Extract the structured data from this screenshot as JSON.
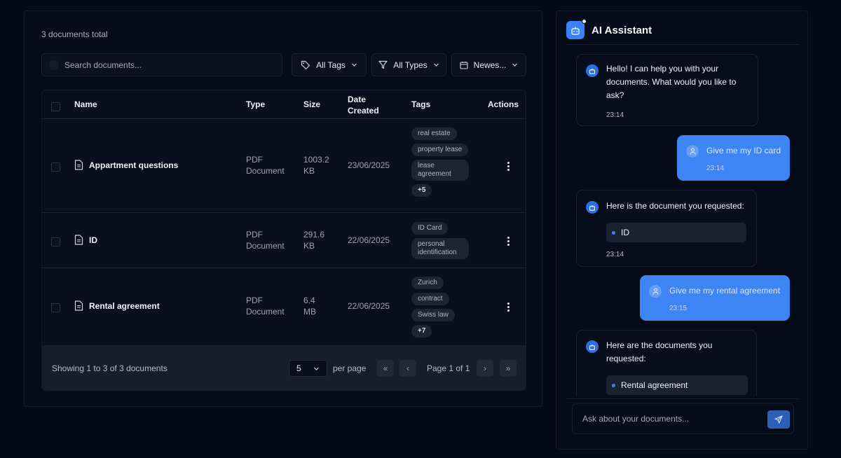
{
  "documents": {
    "count_label": "3 documents total",
    "search": {
      "placeholder": "Search documents..."
    },
    "filters": {
      "tags": "All Tags",
      "types": "All Types",
      "sort": "Newes..."
    },
    "columns": {
      "name": "Name",
      "type_line1": "Type",
      "size": "Size",
      "date_line1": "Date",
      "date_line2": "Created",
      "tags": "Tags",
      "actions": "Actions"
    },
    "rows": [
      {
        "name": "Appartment questions",
        "type_line1": "PDF",
        "type_line2": "Document",
        "size_line1": "1003.2",
        "size_line2": "KB",
        "date": "23/06/2025",
        "tags": [
          "real estate",
          "property lease",
          "lease agreement"
        ],
        "more": "+5"
      },
      {
        "name": "ID",
        "type_line1": "PDF",
        "type_line2": "Document",
        "size_line1": "291.6",
        "size_line2": "KB",
        "date": "22/06/2025",
        "tags": [
          "ID Card",
          "personal identification"
        ],
        "more": ""
      },
      {
        "name": "Rental agreement",
        "type_line1": "PDF",
        "type_line2": "Document",
        "size_line1": "6.4",
        "size_line2": "MB",
        "date": "22/06/2025",
        "tags": [
          "Zurich",
          "contract",
          "Swiss law"
        ],
        "more": "+7"
      }
    ],
    "footer": {
      "showing": "Showing 1 to 3 of 3 documents",
      "per_page_value": "5",
      "per_page_label": "per page",
      "page_info": "Page 1 of 1"
    }
  },
  "assistant": {
    "title": "AI Assistant",
    "messages": [
      {
        "role": "bot",
        "lines": [
          "Hello! I can help you with your",
          "documents. What would you like to",
          "ask?"
        ],
        "time": "23:14"
      },
      {
        "role": "user",
        "text": "Give me my ID card",
        "time": "23:14"
      },
      {
        "role": "bot",
        "lines": [
          "Here is the document you requested:"
        ],
        "doc": "ID",
        "time": "23:14"
      },
      {
        "role": "user",
        "text": "Give me my rental agreement",
        "time": "23:15"
      },
      {
        "role": "bot",
        "lines": [
          "Here are the documents you",
          "requested:"
        ],
        "doc": "Rental agreement",
        "time": ""
      }
    ],
    "input_placeholder": "Ask about your documents..."
  },
  "colors": {
    "accent": "#3b82f6",
    "user_bubble": "#3d84f5",
    "background": "#050a18"
  }
}
